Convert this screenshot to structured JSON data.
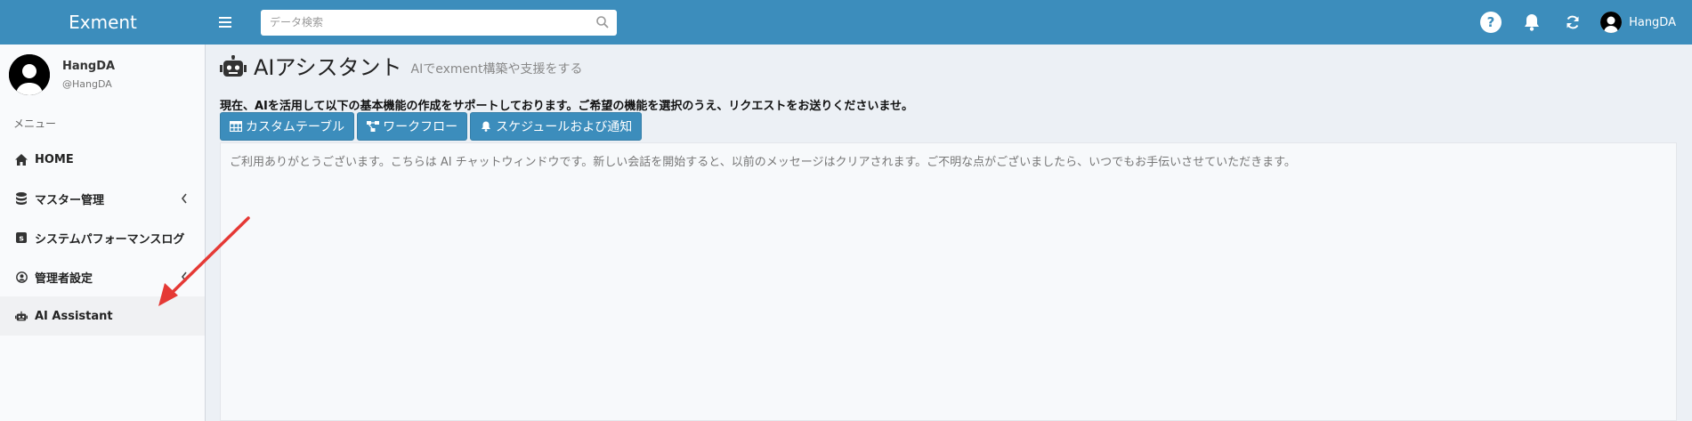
{
  "app": {
    "logo": "Exment"
  },
  "topbar": {
    "search_placeholder": "データ検索",
    "user_name": "HangDA"
  },
  "sidebar": {
    "user": {
      "name": "HangDA",
      "handle": "@HangDA"
    },
    "menu_header": "メニュー",
    "items": [
      {
        "label": "HOME",
        "icon": "home-icon"
      },
      {
        "label": "マスター管理",
        "icon": "database-icon"
      },
      {
        "label": "システムパフォーマンスログ",
        "icon": "log-icon"
      },
      {
        "label": "管理者設定",
        "icon": "user-circle-icon"
      },
      {
        "label": "AI Assistant",
        "icon": "robot-icon"
      }
    ]
  },
  "main": {
    "title": "AIアシスタント",
    "subtitle": "AIでexment構築や支援をする",
    "description": "現在、AIを活用して以下の基本機能の作成をサポートしております。ご希望の機能を選択のうえ、リクエストをお送りくださいませ。",
    "buttons": [
      {
        "label": "カスタムテーブル",
        "icon": "table-icon"
      },
      {
        "label": "ワークフロー",
        "icon": "workflow-icon"
      },
      {
        "label": "スケジュールおよび通知",
        "icon": "bell-icon"
      }
    ],
    "chat_message": "ご利用ありがとうございます。こちらは AI チャットウィンドウです。新しい会話を開始すると、以前のメッセージはクリアされます。ご不明な点がございましたら、いつでもお手伝いさせていただきます。"
  },
  "colors": {
    "brand": "#3c8dbc",
    "annotation_arrow": "#e53935"
  }
}
